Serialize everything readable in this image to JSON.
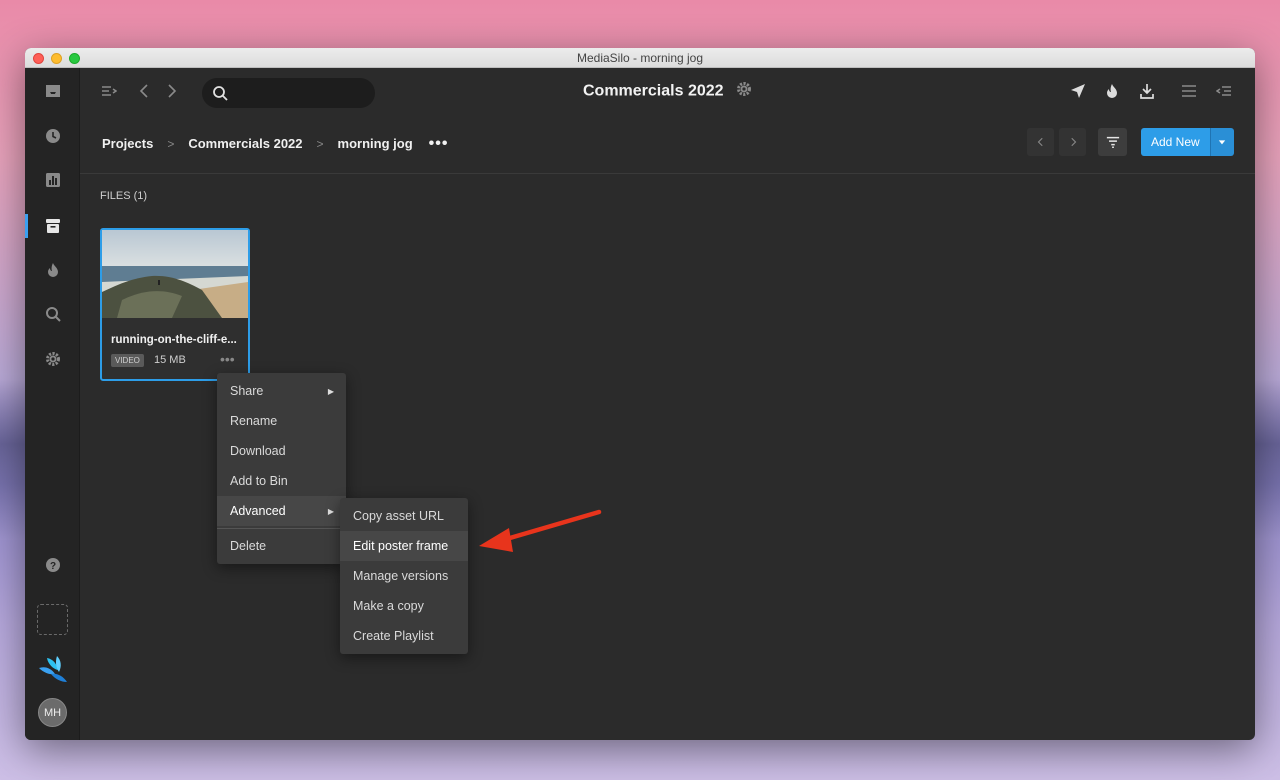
{
  "window": {
    "title": "MediaSilo - morning jog"
  },
  "header": {
    "title": "Commercials 2022",
    "search_placeholder": "",
    "search_value": ""
  },
  "breadcrumb": {
    "items": [
      "Projects",
      "Commercials 2022",
      "morning jog"
    ],
    "sep": ">",
    "more": "•••"
  },
  "toolbar": {
    "add_new_label": "Add New"
  },
  "files": {
    "section_label": "FILES (1)",
    "items": [
      {
        "name": "running-on-the-cliff-e...",
        "type_badge": "VIDEO",
        "size": "15 MB"
      }
    ]
  },
  "context_menu": {
    "items": [
      "Share",
      "Rename",
      "Download",
      "Add to Bin",
      "Advanced",
      "Delete"
    ]
  },
  "submenu": {
    "items": [
      "Copy asset URL",
      "Edit poster frame",
      "Manage versions",
      "Make a copy",
      "Create Playlist"
    ]
  },
  "user": {
    "initials": "MH"
  },
  "colors": {
    "accent": "#2d9de8",
    "arrow": "#e8341c",
    "background": "#2b2b2b"
  },
  "icons": [
    "inbox-icon",
    "clock-icon",
    "chart-icon",
    "archive-icon",
    "flame-icon",
    "search-icon",
    "gear-icon",
    "help-icon",
    "send-icon",
    "download-icon",
    "list-icon",
    "collapse-icon",
    "filter-icon"
  ]
}
